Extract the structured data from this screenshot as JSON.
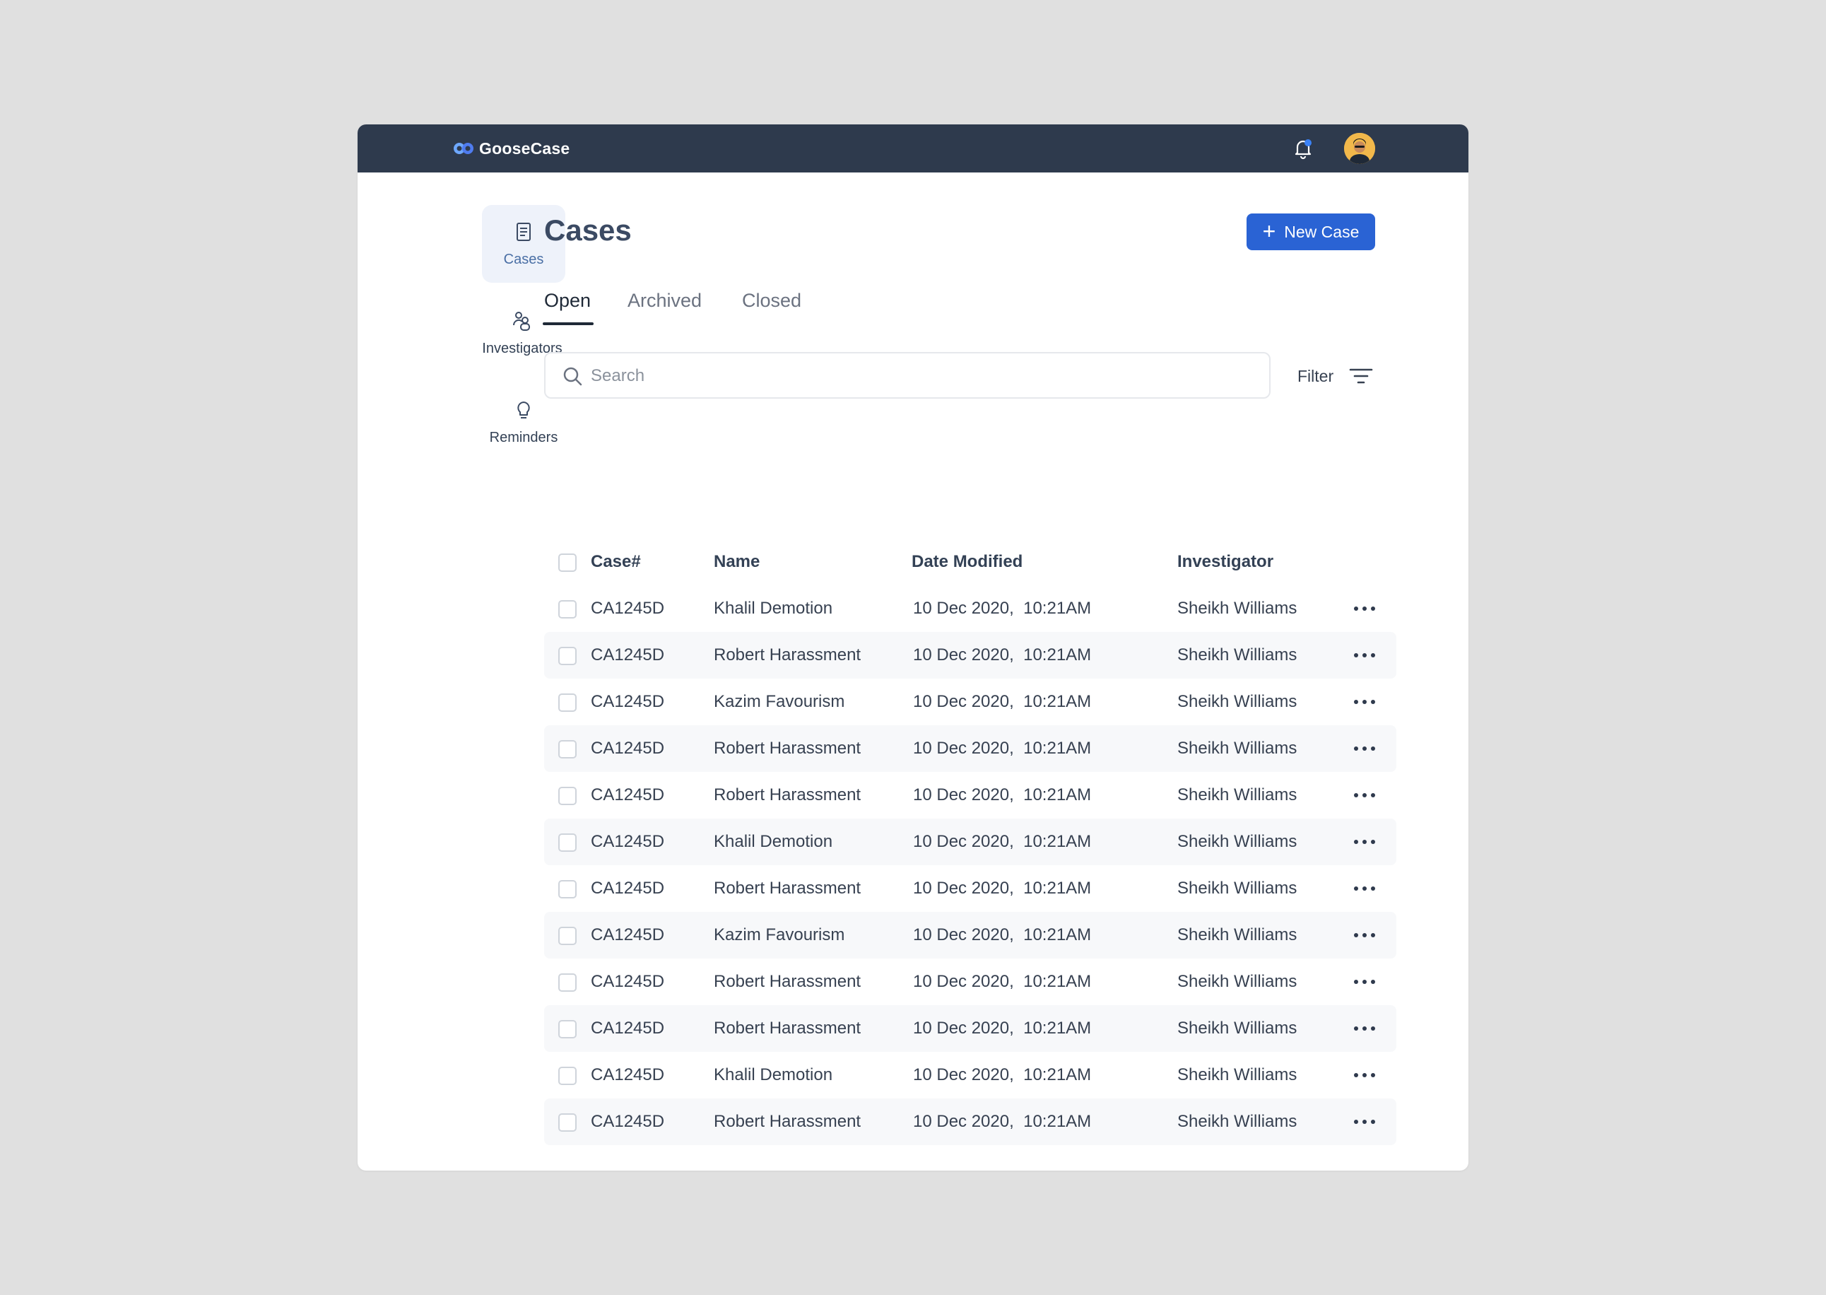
{
  "app": {
    "name": "GooseCase"
  },
  "sidebar": {
    "items": [
      {
        "label": "Cases",
        "icon": "document-icon",
        "active": true
      },
      {
        "label": "Investigators",
        "icon": "users-icon",
        "active": false
      },
      {
        "label": "Reminders",
        "icon": "lightbulb-icon",
        "active": false
      }
    ]
  },
  "page": {
    "title": "Cases",
    "new_button": "New Case"
  },
  "tabs": [
    {
      "label": "Open",
      "active": true
    },
    {
      "label": "Archived",
      "active": false
    },
    {
      "label": "Closed",
      "active": false
    }
  ],
  "search": {
    "placeholder": "Search",
    "value": ""
  },
  "filter": {
    "label": "Filter"
  },
  "table": {
    "columns": [
      "Case#",
      "Name",
      "Date Modified",
      "Investigator"
    ],
    "rows": [
      {
        "case": "CA1245D",
        "name": "Khalil Demotion",
        "date": "10 Dec 2020,  10:21AM",
        "investigator": "Sheikh Williams"
      },
      {
        "case": "CA1245D",
        "name": "Robert Harassment",
        "date": "10 Dec 2020,  10:21AM",
        "investigator": "Sheikh Williams"
      },
      {
        "case": "CA1245D",
        "name": "Kazim Favourism",
        "date": "10 Dec 2020,  10:21AM",
        "investigator": "Sheikh Williams"
      },
      {
        "case": "CA1245D",
        "name": "Robert Harassment",
        "date": "10 Dec 2020,  10:21AM",
        "investigator": "Sheikh Williams"
      },
      {
        "case": "CA1245D",
        "name": "Robert Harassment",
        "date": "10 Dec 2020,  10:21AM",
        "investigator": "Sheikh Williams"
      },
      {
        "case": "CA1245D",
        "name": "Khalil Demotion",
        "date": "10 Dec 2020,  10:21AM",
        "investigator": "Sheikh Williams"
      },
      {
        "case": "CA1245D",
        "name": "Robert Harassment",
        "date": "10 Dec 2020,  10:21AM",
        "investigator": "Sheikh Williams"
      },
      {
        "case": "CA1245D",
        "name": "Kazim Favourism",
        "date": "10 Dec 2020,  10:21AM",
        "investigator": "Sheikh Williams"
      },
      {
        "case": "CA1245D",
        "name": "Robert Harassment",
        "date": "10 Dec 2020,  10:21AM",
        "investigator": "Sheikh Williams"
      },
      {
        "case": "CA1245D",
        "name": "Robert Harassment",
        "date": "10 Dec 2020,  10:21AM",
        "investigator": "Sheikh Williams"
      },
      {
        "case": "CA1245D",
        "name": "Khalil Demotion",
        "date": "10 Dec 2020,  10:21AM",
        "investigator": "Sheikh Williams"
      },
      {
        "case": "CA1245D",
        "name": "Robert Harassment",
        "date": "10 Dec 2020,  10:21AM",
        "investigator": "Sheikh Williams"
      }
    ]
  },
  "colors": {
    "topbar": "#2e3a4d",
    "accent": "#2a63d4",
    "notification_dot": "#3b82f6",
    "row_stripe": "#f7f8fa"
  }
}
